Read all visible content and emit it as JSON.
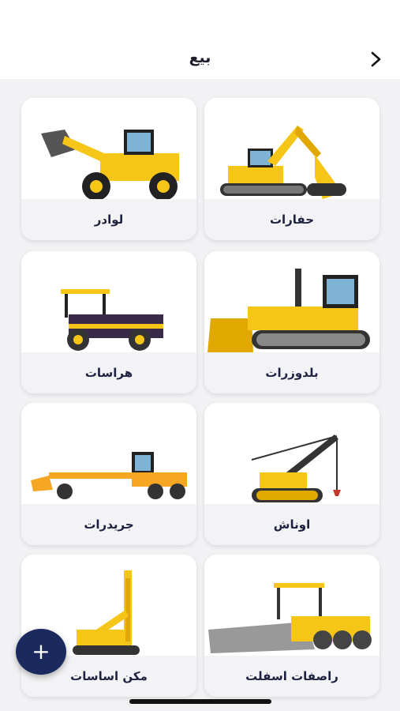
{
  "header": {
    "title": "بيع",
    "back_icon": "chevron-right-icon"
  },
  "categories": [
    {
      "label": "حفارات",
      "icon": "excavator-icon"
    },
    {
      "label": "لوادر",
      "icon": "loader-icon"
    },
    {
      "label": "بلدوزرات",
      "icon": "bulldozer-icon"
    },
    {
      "label": "هراسات",
      "icon": "road-roller-icon"
    },
    {
      "label": "اوناش",
      "icon": "crane-icon"
    },
    {
      "label": "جريدرات",
      "icon": "grader-icon"
    },
    {
      "label": "راصفات اسفلت",
      "icon": "asphalt-paver-icon"
    },
    {
      "label": "مكن اساسات",
      "icon": "piling-rig-icon"
    }
  ],
  "fab": {
    "symbol": "+",
    "icon": "plus-icon"
  },
  "colors": {
    "accent": "#1b2a5e",
    "machine_yellow": "#f5c518",
    "text": "#1e2140"
  }
}
